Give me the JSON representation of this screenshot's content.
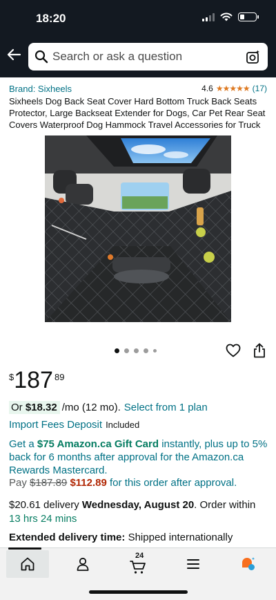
{
  "status_bar": {
    "time": "18:20",
    "battery_percent": 30
  },
  "search": {
    "placeholder": "Search or ask a question"
  },
  "product": {
    "brand": "Brand: Sixheels",
    "rating": "4.6",
    "stars": "★★★★★",
    "rating_count": "(17)",
    "title": "Sixheels Dog Back Seat Cover Hard Bottom Truck Back Seats Protector, Large Backseat Extender for Dogs, Car Pet Rear Seat Covers Waterproof Dog Hammock Travel Accessories for Truck",
    "image_alt": "Black quilted dog back seat cover installed in truck"
  },
  "carousel": {
    "count": 5,
    "active_index": 0
  },
  "price": {
    "symbol": "$",
    "whole": "187",
    "cents": "89"
  },
  "monthly": {
    "or": "Or",
    "amount": "$18.32",
    "rest": "/mo (12 mo).",
    "link": "Select from 1 plan"
  },
  "import": {
    "link": "Import Fees Deposit",
    "note": "Included"
  },
  "promo": {
    "prefix": "Get a",
    "gift_card": "$75 Amazon.ca Gift Card",
    "text": "instantly, plus up to 5% back for 6 months after approval for the Amazon.ca Rewards Mastercard.",
    "pay_label": "Pay",
    "old_price": "$187.89",
    "new_price": "$112.89",
    "suffix": "for this order after approval."
  },
  "delivery": {
    "price": "$20.61 delivery",
    "date": "Wednesday, August 20",
    "order_within": ". Order within",
    "countdown": "13 hrs 24 mins"
  },
  "extended": {
    "label": "Extended delivery time:",
    "text": "Shipped internationally"
  },
  "tabbar": {
    "cart_count": "24",
    "items": [
      "home",
      "account",
      "cart",
      "menu",
      "rufus"
    ]
  },
  "colors": {
    "header_bg": "#131921",
    "link": "#007185",
    "green": "#067D62",
    "red": "#B12704",
    "star": "#DE7921"
  }
}
